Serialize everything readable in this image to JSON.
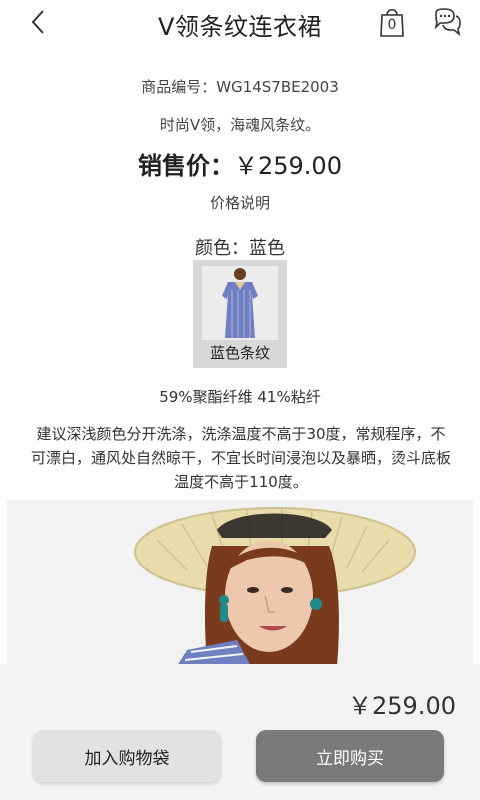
{
  "header": {
    "title": "V领条纹连衣裙",
    "bag_count": "0",
    "back_icon": "chevron-left-icon",
    "bag_icon": "shopping-bag-icon",
    "chat_icon": "chat-bubbles-icon"
  },
  "product": {
    "code": "商品编号：WG14S7BE2003",
    "slogan": "时尚V领，海魂风条纹。",
    "price_label": "销售价：",
    "price_value": "￥259.00",
    "price_note": "价格说明",
    "color_label": "颜色：蓝色",
    "swatch_label": "蓝色条纹",
    "material": "59%聚酯纤维 41%粘纤",
    "care": "建议深浅颜色分开洗涤，洗涤温度不高于30度，常规程序，不可漂白，通风处自然晾干，不宜长时间浸泡以及暴晒，烫斗底板温度不高于110度。"
  },
  "bottom_bar": {
    "total": "￥259.00",
    "add_to_cart": "加入购物袋",
    "buy_now": "立即购买"
  },
  "colors": {
    "dress_blue": "#6f7fc2",
    "hat_straw": "#e8dcaa",
    "hair": "#7a3a1c",
    "earring_teal": "#1f8a8a"
  }
}
